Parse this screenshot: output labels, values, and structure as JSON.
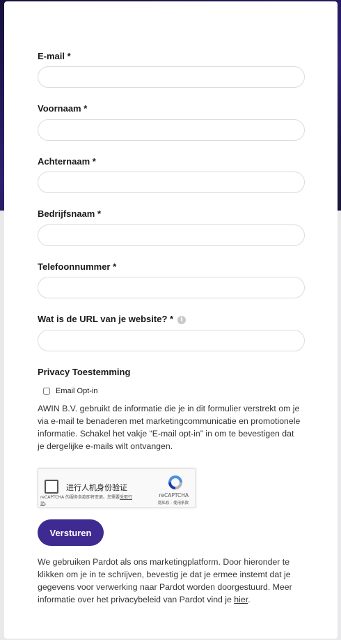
{
  "form": {
    "fields": [
      {
        "label": "E-mail *",
        "value": "",
        "placeholder": ""
      },
      {
        "label": "Voornaam *",
        "value": "",
        "placeholder": ""
      },
      {
        "label": "Achternaam *",
        "value": "",
        "placeholder": ""
      },
      {
        "label": "Bedrijfsnaam *",
        "value": "",
        "placeholder": ""
      },
      {
        "label": "Telefoonnummer *",
        "value": "",
        "placeholder": ""
      },
      {
        "label": "Wat is de URL van je website? *",
        "value": "",
        "placeholder": "",
        "info_icon": "info-icon"
      }
    ],
    "privacy": {
      "heading": "Privacy Toestemming",
      "optin_label": "Email Opt-in",
      "optin_checked": false,
      "text": "AWIN B.V. gebruikt de informatie die je in dit formulier verstrekt om je via e-mail te benaderen met marketingcommunicatie en promotionele informatie. Schakel het vakje “E-mail opt-in” in om te bevestigen dat je dergelijke e-mails wilt ontvangen."
    },
    "captcha": {
      "label": "进行人机身份验证",
      "note": "reCAPTCHA 的服务条款即将变更。您需要",
      "note_link": "采取行动",
      "note_end": "。",
      "brand": "reCAPTCHA",
      "terms": "隐私权 - 使用条款"
    },
    "submit_label": "Versturen",
    "footer": {
      "text": "We gebruiken Pardot als ons marketingplatform. Door hieronder te klikken om je in te schrijven, bevestig je dat je ermee instemt dat je gegevens voor verwerking naar Pardot worden doorgestuurd. Meer informatie over het privacybeleid van Pardot vind je ",
      "link": "hier",
      "end": "."
    }
  },
  "colors": {
    "accent": "#3e2a91",
    "background_top": "#241a5e",
    "input_border": "#dcdcdc"
  }
}
